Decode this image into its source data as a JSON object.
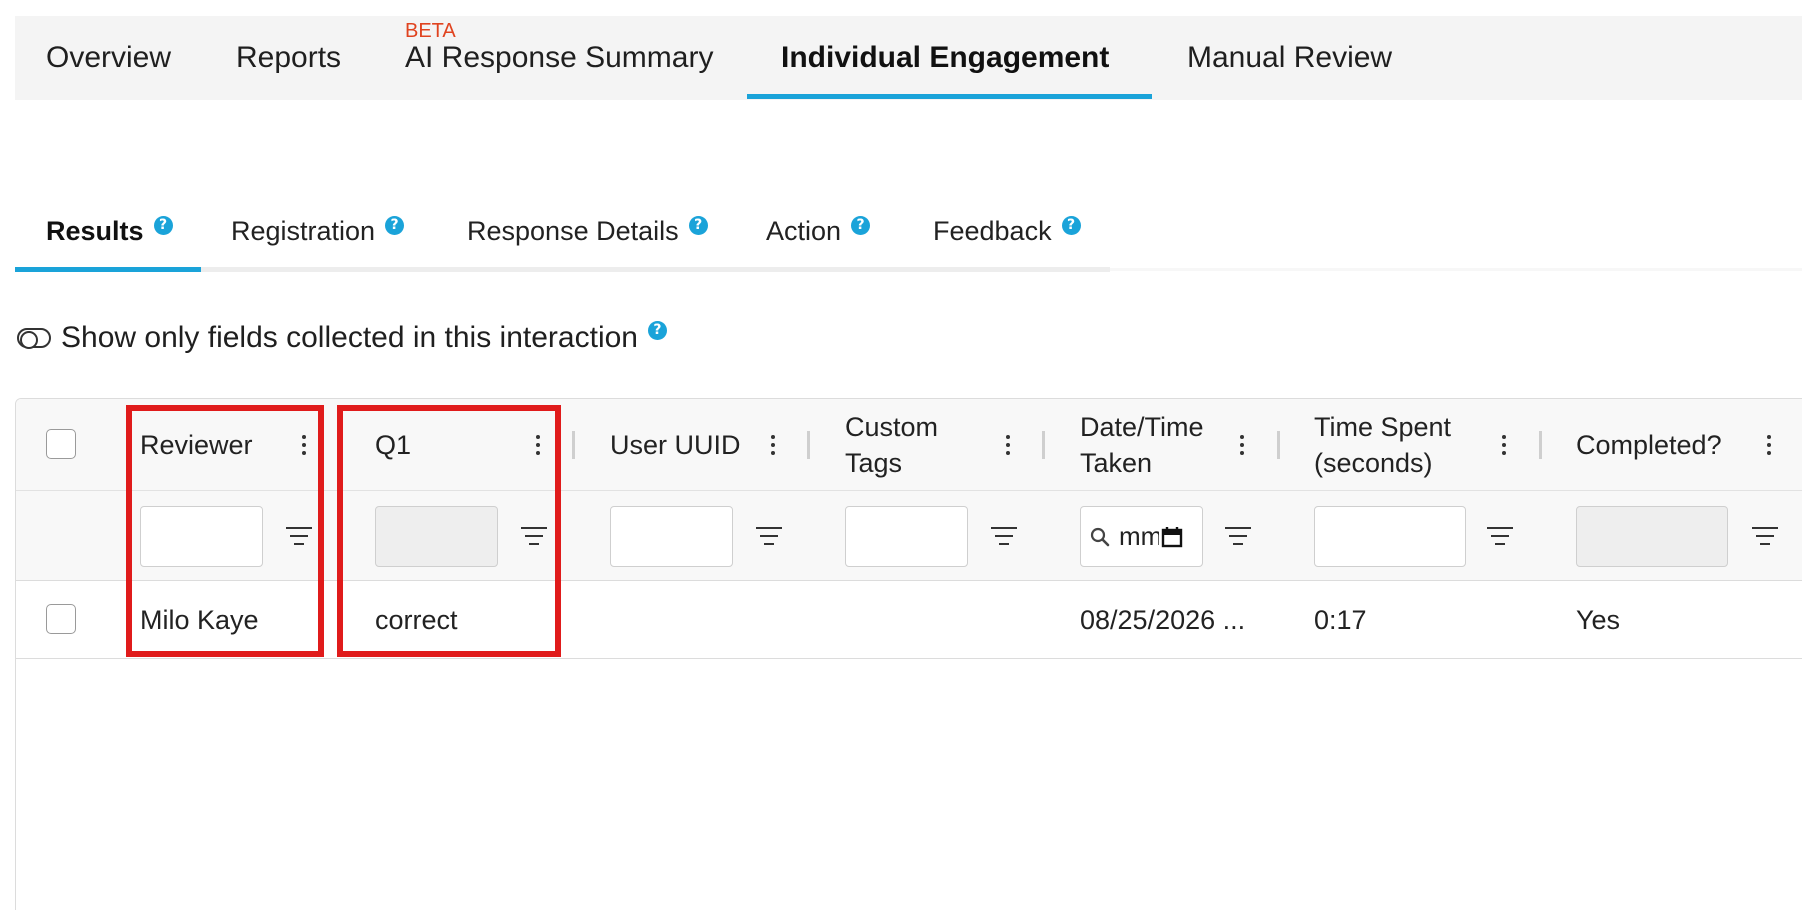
{
  "top_tabs": {
    "overview": "Overview",
    "reports": "Reports",
    "ai_beta": "BETA",
    "ai_summary": "AI Response Summary",
    "individual_engagement": "Individual Engagement",
    "manual_review": "Manual Review",
    "active": "Individual Engagement"
  },
  "sub_tabs": {
    "results": "Results",
    "registration": "Registration",
    "response_details": "Response Details",
    "action": "Action",
    "feedback": "Feedback",
    "help_glyph": "?",
    "active": "Results"
  },
  "toggle": {
    "label": "Show only fields collected in this interaction",
    "checked": false
  },
  "grid": {
    "columns": {
      "reviewer": "Reviewer",
      "q1": "Q1",
      "user_uuid": "User UUID",
      "custom_tags_1": "Custom",
      "custom_tags_2": "Tags",
      "date_1": "Date/Time",
      "date_2": "Taken",
      "time_1": "Time Spent",
      "time_2": "(seconds)",
      "completed": "Completed?"
    },
    "filters": {
      "date_value": "mm/dd/yyyy"
    },
    "rows": [
      {
        "reviewer": "Milo Kaye",
        "q1": "correct",
        "user_uuid": "",
        "custom_tags": "",
        "date_time_taken": "08/25/2026 ...",
        "time_spent": "0:17",
        "completed": "Yes"
      }
    ]
  },
  "colors": {
    "accent": "#1aa3d9",
    "beta": "#e0431f",
    "highlight": "#e01b1b"
  }
}
